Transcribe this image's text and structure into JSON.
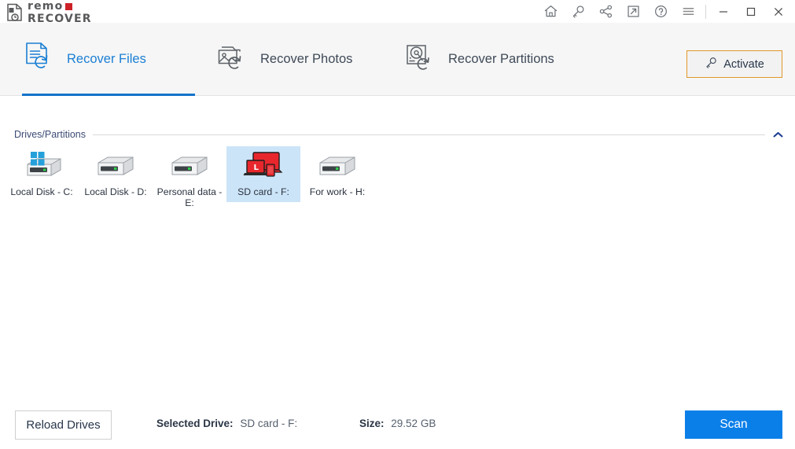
{
  "app": {
    "logo_line1": "remo",
    "logo_line2": "RECOVER"
  },
  "titlebar": {
    "icons": [
      {
        "name": "home-icon",
        "label": "Home"
      },
      {
        "name": "key-icon",
        "label": "Activate Key"
      },
      {
        "name": "share-icon",
        "label": "Share"
      },
      {
        "name": "external-link-icon",
        "label": "Open External"
      },
      {
        "name": "help-icon",
        "label": "Help"
      },
      {
        "name": "menu-icon",
        "label": "Menu"
      }
    ],
    "window_controls": [
      {
        "name": "minimize-button",
        "glyph": "minimize"
      },
      {
        "name": "maximize-button",
        "glyph": "maximize"
      },
      {
        "name": "close-button",
        "glyph": "close"
      }
    ]
  },
  "tabs": [
    {
      "label": "Recover Files",
      "icon": "recover-files-icon",
      "active": true
    },
    {
      "label": "Recover Photos",
      "icon": "recover-photos-icon",
      "active": false
    },
    {
      "label": "Recover Partitions",
      "icon": "recover-partitions-icon",
      "active": false
    }
  ],
  "activate": {
    "label": "Activate",
    "icon": "key-icon",
    "border_color": "#e0982a"
  },
  "drives_section": {
    "title": "Drives/Partitions",
    "collapse_icon": "chevron-up-icon",
    "drives": [
      {
        "label": "Local Disk - C:",
        "icon": "system-drive-icon",
        "selected": false
      },
      {
        "label": "Local Disk - D:",
        "icon": "drive-icon",
        "selected": false
      },
      {
        "label": "Personal data - E:",
        "icon": "drive-icon",
        "selected": false
      },
      {
        "label": "SD card - F:",
        "icon": "media-device-icon",
        "selected": true
      },
      {
        "label": "For work - H:",
        "icon": "drive-icon",
        "selected": false
      }
    ]
  },
  "footer": {
    "reload_label": "Reload Drives",
    "selected_drive_label": "Selected Drive:",
    "selected_drive_value": "SD card - F:",
    "size_label": "Size:",
    "size_value": "29.52 GB",
    "scan_label": "Scan"
  },
  "colors": {
    "accent_blue": "#0b7fe8",
    "tab_active": "#1b7fd4",
    "selection_blue": "#cce4f7",
    "activate_orange": "#e0982a",
    "logo_red": "#cc2127"
  }
}
